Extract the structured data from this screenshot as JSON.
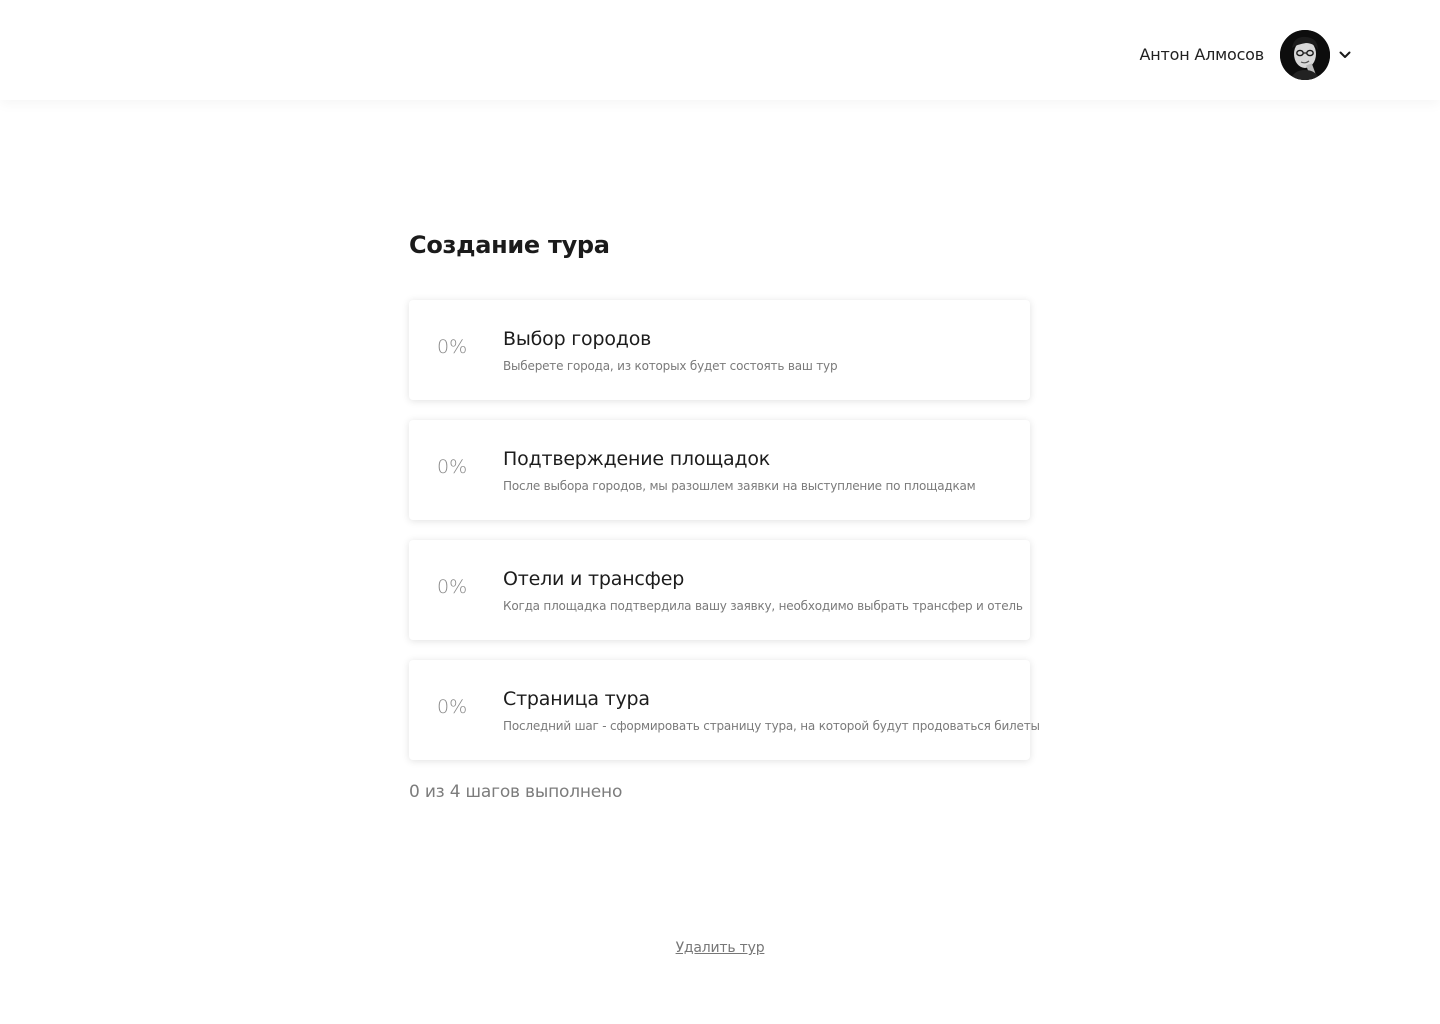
{
  "header": {
    "user_name": "Антон Алмосов",
    "avatar_icon": "user-avatar",
    "dropdown_icon": "chevron-down-icon"
  },
  "main": {
    "title": "Создание тура",
    "steps": [
      {
        "percent": "0%",
        "progress": 0,
        "title": "Выбор городов",
        "description": "Выберете города, из которых будет состоять ваш тур"
      },
      {
        "percent": "0%",
        "progress": 0,
        "title": "Подтверждение площадок",
        "description": "После выбора городов, мы разошлем заявки на выступление по площадкам"
      },
      {
        "percent": "0%",
        "progress": 0,
        "title": "Отели и трансфер",
        "description": "Когда площадка подтвердила вашу заявку, необходимо выбрать трансфер и отель"
      },
      {
        "percent": "0%",
        "progress": 0,
        "title": "Страница тура",
        "description": "Последний шаг - сформировать страницу тура, на которой будут продоваться билеты"
      }
    ],
    "progress_text": "0 из 4 шагов выполнено",
    "delete_label": "Удалить тур"
  },
  "colors": {
    "text_primary": "#1c1c1c",
    "text_secondary": "#7a7a7a",
    "card_background": "#ffffff"
  }
}
